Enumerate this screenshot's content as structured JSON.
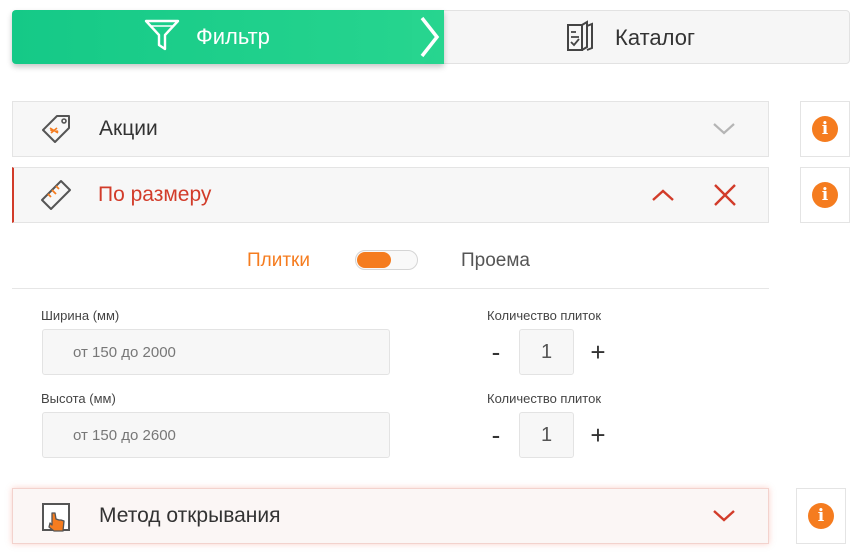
{
  "tabs": {
    "filter_label": "Фильтр",
    "catalog_label": "Каталог",
    "filter_icon": "funnel-icon",
    "catalog_icon": "catalog-book-icon"
  },
  "accordion": {
    "promotions": {
      "label": "Акции",
      "icon": "price-tag-icon",
      "state": "collapsed"
    },
    "by_size": {
      "label": "По размеру",
      "icon": "ruler-icon",
      "state": "expanded"
    },
    "opening_method": {
      "label": "Метод открывания",
      "icon": "door-hand-icon",
      "state": "collapsed"
    }
  },
  "size_panel": {
    "toggle_left": "Плитки",
    "toggle_right": "Проема",
    "width_label": "Ширина (мм)",
    "width_placeholder": "от 150 до 2000",
    "height_label": "Высота (мм)",
    "height_placeholder": "от 150 до 2600",
    "count_label_1": "Количество плиток",
    "count_value_1": "1",
    "count_label_2": "Количество плиток",
    "count_value_2": "1",
    "minus": "-",
    "plus": "+"
  },
  "colors": {
    "accent_green": "#1fcf8b",
    "accent_orange": "#f57c1f",
    "accent_red": "#d23c2a"
  }
}
